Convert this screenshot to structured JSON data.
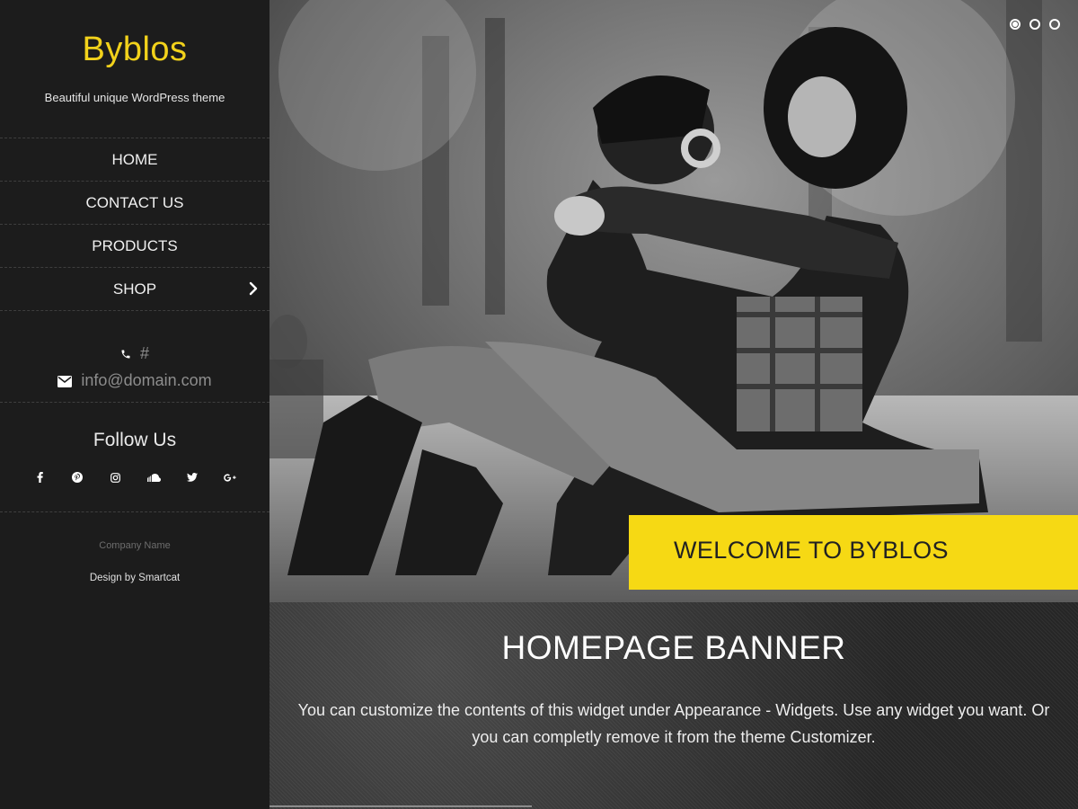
{
  "site": {
    "title": "Byblos",
    "tagline": "Beautiful unique WordPress theme"
  },
  "nav": {
    "items": [
      {
        "label": "HOME"
      },
      {
        "label": "CONTACT US"
      },
      {
        "label": "PRODUCTS"
      },
      {
        "label": "SHOP",
        "has_submenu": true
      }
    ]
  },
  "contact": {
    "phone": "#",
    "email": "info@domain.com"
  },
  "follow": {
    "title": "Follow Us",
    "networks": [
      "facebook-icon",
      "pinterest-icon",
      "instagram-icon",
      "soundcloud-icon",
      "twitter-icon",
      "google-plus-icon"
    ]
  },
  "footer": {
    "company": "Company Name",
    "credit": "Design by Smartcat"
  },
  "slider": {
    "slide_count": 3,
    "active_index": 0,
    "caption": "WELCOME TO BYBLOS"
  },
  "banner": {
    "title": "HOMEPAGE BANNER",
    "text": "You can customize the contents of this widget under Appearance - Widgets. Use any widget you want. Or you can completly remove it from the theme Customizer."
  },
  "colors": {
    "accent": "#f6d914",
    "sidebar_bg": "#1c1c1c",
    "muted_text": "#8d8d8d"
  }
}
